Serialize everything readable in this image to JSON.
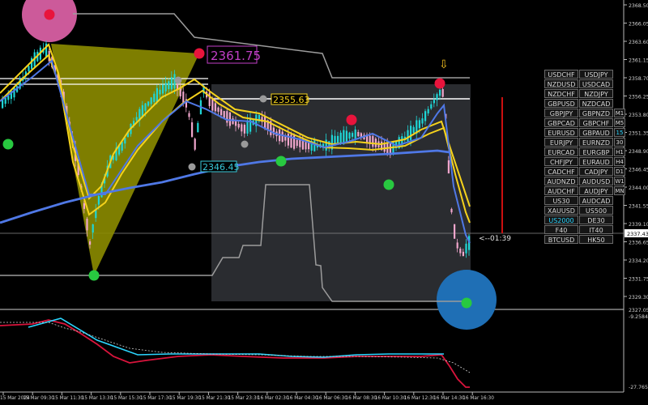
{
  "colors": {
    "background": "#000000",
    "axis": "#b9b9b9",
    "bull_candle": "#1fd6d6",
    "bear_candle": "#f0a6cc",
    "ma_yellow": "#f5d21c",
    "ma_blue": "#4f78e6",
    "triangle_fill": "#8c8c00",
    "signal_up": "#28c940",
    "signal_down": "#e8143c",
    "signal_neutral": "#9a9a9a",
    "osc_red": "#d8143c",
    "osc_cyan": "#2bd6ff",
    "panel_box": "#2a2c30",
    "pink_circle": "#cc5a9a",
    "blue_circle": "#1f6fb5"
  },
  "price_axis": {
    "ticks": [
      "2368.50",
      "2366.05",
      "2363.60",
      "2361.15",
      "2358.70",
      "2356.25",
      "2353.80",
      "2351.35",
      "2348.90",
      "2346.45",
      "2344.00",
      "2341.55",
      "2339.10",
      "2336.65",
      "2334.20",
      "2331.75",
      "2329.30"
    ],
    "current_price_label": "2337.43"
  },
  "osc_axis": {
    "ticks": [
      "2327.05",
      "-9.2584",
      "-27.7657"
    ]
  },
  "time_axis": {
    "ticks": [
      "15 Mar 2024",
      "15 Mar 09:30",
      "15 Mar 11:30",
      "15 Mar 13:30",
      "15 Mar 15:30",
      "15 Mar 17:30",
      "15 Mar 19:30",
      "15 Mar 21:30",
      "15 Mar 23:30",
      "16 Mar 02:30",
      "16 Mar 04:30",
      "16 Mar 06:30",
      "16 Mar 08:30",
      "16 Mar 10:30",
      "16 Mar 12:30",
      "16 Mar 14:30",
      "16 Mar 16:30"
    ]
  },
  "annotations": {
    "peak_label": "2361.75",
    "high_label": "2355.63",
    "low_label": "2346.45",
    "countdown": "<--01:39",
    "arrow_down": "⇩"
  },
  "symbols": [
    {
      "left": "USDCHF",
      "right": "USDJPY",
      "tf": ""
    },
    {
      "left": "NZDUSD",
      "right": "USDCAD",
      "tf": ""
    },
    {
      "left": "NZDCHF",
      "right": "NZDJPY",
      "tf": ""
    },
    {
      "left": "GBPUSD",
      "right": "NZDCAD",
      "tf": ""
    },
    {
      "left": "GBPJPY",
      "right": "GBPNZD",
      "tf": "M1"
    },
    {
      "left": "GBPCAD",
      "right": "GBPCHF",
      "tf": "M5"
    },
    {
      "left": "EURUSD",
      "right": "GBPAUD",
      "tf": "15"
    },
    {
      "left": "EURJPY",
      "right": "EURNZD",
      "tf": "30"
    },
    {
      "left": "EURCAD",
      "right": "EURGBP",
      "tf": "H1"
    },
    {
      "left": "CHFJPY",
      "right": "EURAUD",
      "tf": "H4"
    },
    {
      "left": "CADCHF",
      "right": "CADJPY",
      "tf": "D1"
    },
    {
      "left": "AUDNZD",
      "right": "AUDUSD",
      "tf": "W1"
    },
    {
      "left": "AUDCHF",
      "right": "AUDJPY",
      "tf": "MN"
    },
    {
      "left": "US30",
      "right": "AUDCAD",
      "tf": ""
    },
    {
      "left": "XAUUSD",
      "right": "US500",
      "tf": ""
    },
    {
      "left": "US2000",
      "right": "DE30",
      "tf": ""
    },
    {
      "left": "F40",
      "right": "IT40",
      "tf": ""
    },
    {
      "left": "BTCUSD",
      "right": "HK50",
      "tf": ""
    }
  ],
  "active_symbol": "US2000",
  "active_timeframe": "15"
}
